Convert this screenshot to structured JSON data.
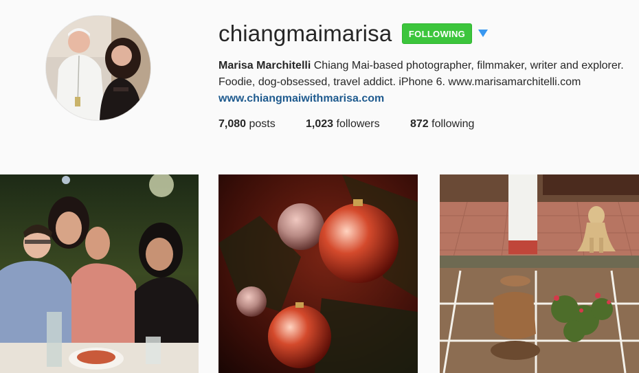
{
  "profile": {
    "username": "chiangmaimarisa",
    "follow_button_label": "FOLLOWING",
    "full_name": "Marisa Marchitelli",
    "bio_line1": "Chiang Mai-based photographer, filmmaker, writer and explorer.",
    "bio_line2": "Foodie, dog-obsessed, travel addict. iPhone 6. www.marisamarchitelli.com",
    "website": "www.chiangmaiwithmarisa.com"
  },
  "stats": {
    "posts_count": "7,080",
    "posts_label": "posts",
    "followers_count": "1,023",
    "followers_label": "followers",
    "following_count": "872",
    "following_label": "following"
  },
  "colors": {
    "follow_green": "#3cc53c",
    "link_blue": "#1e5a8e",
    "dropdown_blue": "#3897f0",
    "background": "#fafafa"
  },
  "icons": {
    "dropdown": "caret-down-icon"
  },
  "photos": [
    {
      "subject": "group-of-friends-at-dinner"
    },
    {
      "subject": "red-christmas-ornaments"
    },
    {
      "subject": "dog-on-tiled-patio"
    }
  ]
}
